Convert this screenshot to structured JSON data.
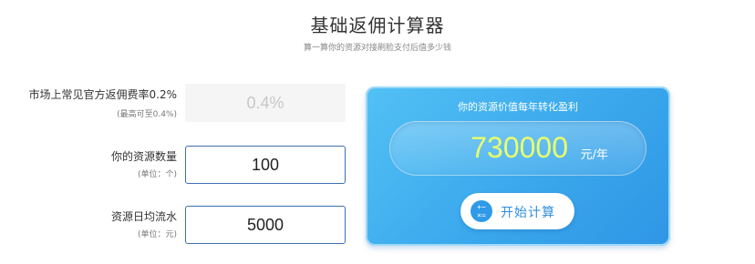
{
  "header": {
    "title": "基础返佣计算器",
    "subtitle": "算一算你的资源对接刷脸支付后值多少钱"
  },
  "form": {
    "rows": [
      {
        "label": "市场上常见官方返佣费率0.2%",
        "hint": "(最高可至0.4%)",
        "value": "0.4%"
      },
      {
        "label": "你的资源数量",
        "hint": "(单位：个)",
        "value": "100"
      },
      {
        "label": "资源日均流水",
        "hint": "(单位：元)",
        "value": "5000"
      }
    ]
  },
  "result_panel": {
    "title": "你的资源价值每年转化盈利",
    "value": "730000",
    "unit": "元/年",
    "button_label": "开始计算",
    "icon": "calculator-icon",
    "icon_glyph_top": "+−",
    "icon_glyph_bottom": "×=",
    "colors": {
      "panel": "#3aa8ec",
      "value": "#e8ff6a",
      "field_border": "#3d6fb6"
    }
  }
}
